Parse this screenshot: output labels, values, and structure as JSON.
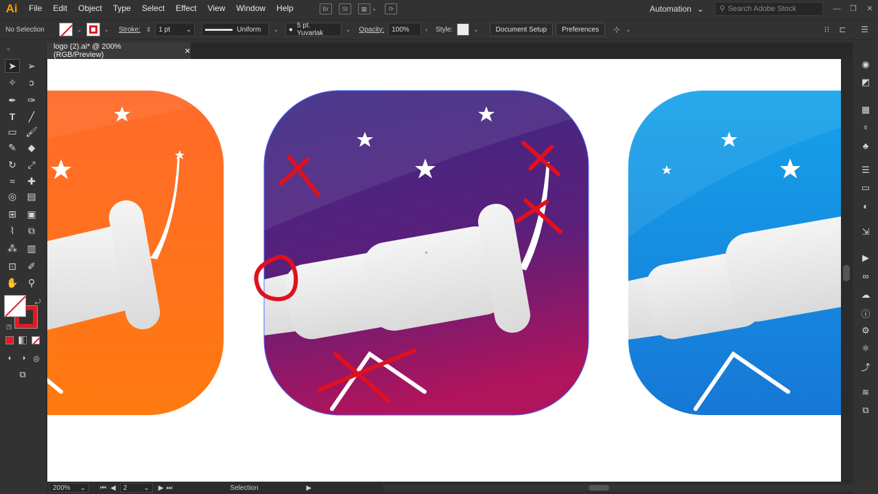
{
  "app": {
    "logo": "Ai"
  },
  "menu": [
    "File",
    "Edit",
    "Object",
    "Type",
    "Select",
    "Effect",
    "View",
    "Window",
    "Help"
  ],
  "bridge_icons": [
    "Br",
    "St"
  ],
  "workspace": "Automation",
  "search_placeholder": "Search Adobe Stock",
  "control": {
    "selection_label": "No Selection",
    "stroke_label": "Stroke:",
    "stroke_weight": "1 pt",
    "profile": "Uniform",
    "brush": "5 pt. Yuvarlak",
    "opacity_label": "Opacity:",
    "opacity_value": "100%",
    "style_label": "Style:",
    "document_setup": "Document Setup",
    "preferences": "Preferences"
  },
  "tab": {
    "title": "logo (2).ai* @ 200% (RGB/Preview)",
    "close": "✕"
  },
  "status": {
    "zoom": "200%",
    "artboard": "2",
    "tool": "Selection"
  },
  "colors": {
    "orange_top": "#ff6a2a",
    "orange_bottom": "#ff7a10",
    "purple_top": "#3b2a85",
    "purple_bottom": "#b0145c",
    "blue_top": "#15a3ea",
    "blue_bottom": "#1677d6",
    "markup_red": "#e0101e"
  }
}
